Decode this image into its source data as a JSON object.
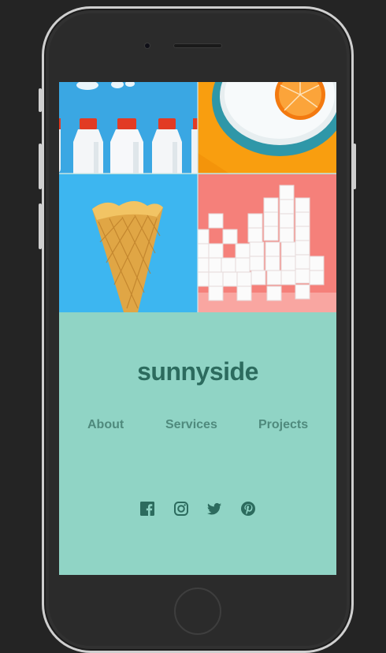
{
  "brand": {
    "name": "sunnyside"
  },
  "footer": {
    "nav": [
      {
        "label": "About"
      },
      {
        "label": "Services"
      },
      {
        "label": "Projects"
      }
    ]
  },
  "social": [
    {
      "icon": "facebook-icon"
    },
    {
      "icon": "instagram-icon"
    },
    {
      "icon": "twitter-icon"
    },
    {
      "icon": "pinterest-icon"
    }
  ],
  "colors": {
    "footer_bg": "#90d4c5",
    "brand_text": "#2c6b5e",
    "nav_text": "#4f8a7d",
    "icon": "#2c6b5e",
    "phone_frame": "#cfcfcf",
    "page_bg": "#242424"
  }
}
